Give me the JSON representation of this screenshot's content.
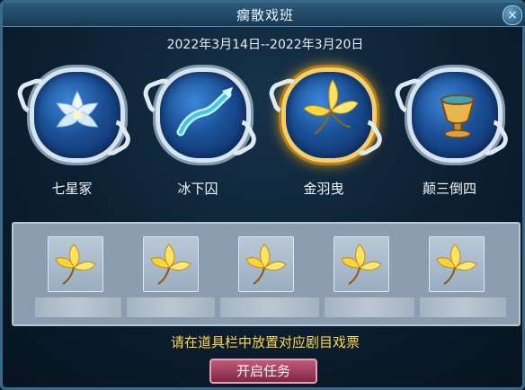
{
  "window": {
    "title": "瘸散戏班"
  },
  "date_range": "2022年3月14日--2022年3月20日",
  "stages": [
    {
      "label": "七星冢",
      "icon": "lotus-icon",
      "selected": false
    },
    {
      "label": "冰下囚",
      "icon": "ice-dragon-icon",
      "selected": false
    },
    {
      "label": "金羽曳",
      "icon": "golden-feather-icon",
      "selected": true
    },
    {
      "label": "颠三倒四",
      "icon": "golden-cup-icon",
      "selected": false
    }
  ],
  "tray": {
    "slots": [
      {
        "icon": "golden-leaf-ticket-icon"
      },
      {
        "icon": "golden-leaf-ticket-icon"
      },
      {
        "icon": "golden-leaf-ticket-icon"
      },
      {
        "icon": "golden-leaf-ticket-icon"
      },
      {
        "icon": "golden-leaf-ticket-icon"
      }
    ]
  },
  "hint": "请在道具栏中放置对应剧目戏票",
  "start_button": "开启任务",
  "colors": {
    "hint": "#ffd84a",
    "selected_ring": "#f2cf6a",
    "button": "#a03a5c"
  }
}
